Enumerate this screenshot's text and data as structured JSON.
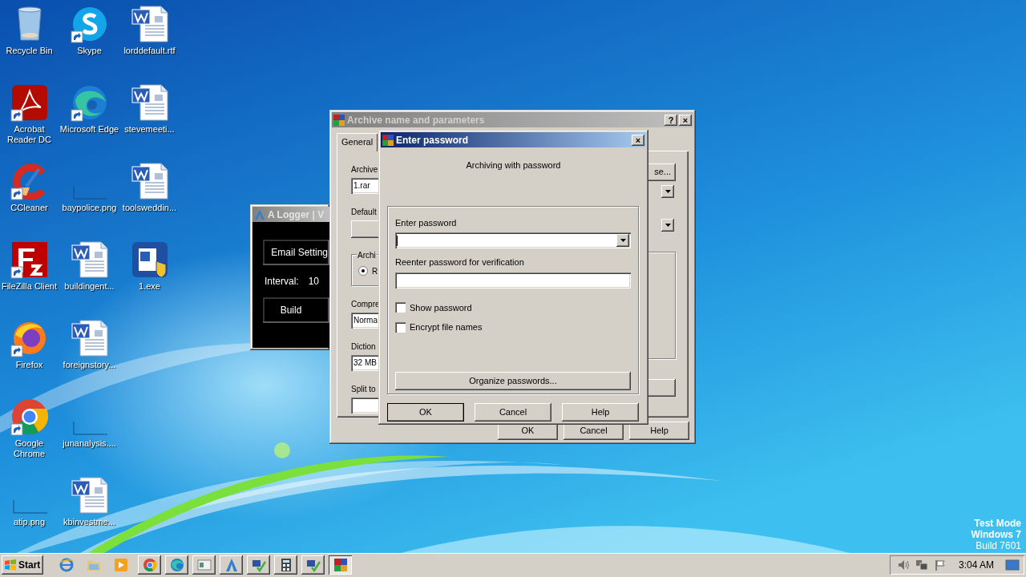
{
  "desktop_icons": [
    {
      "label": "Recycle Bin",
      "kind": "recycle",
      "shortcut": false
    },
    {
      "label": "Acrobat\nReader DC",
      "kind": "acrobat",
      "shortcut": true
    },
    {
      "label": "CCleaner",
      "kind": "ccleaner",
      "shortcut": true
    },
    {
      "label": "FileZilla Client",
      "kind": "filezilla",
      "shortcut": true
    },
    {
      "label": "Firefox",
      "kind": "firefox",
      "shortcut": true
    },
    {
      "label": "Google\nChrome",
      "kind": "chrome",
      "shortcut": true
    },
    {
      "label": "atip.png",
      "kind": "blank",
      "shortcut": false
    },
    {
      "label": "Skype",
      "kind": "skype",
      "shortcut": true
    },
    {
      "label": "Microsoft Edge",
      "kind": "edge",
      "shortcut": true
    },
    {
      "label": "baypolice.png",
      "kind": "blank",
      "shortcut": false
    },
    {
      "label": "buildingent...",
      "kind": "word",
      "shortcut": false
    },
    {
      "label": "foreignstory...",
      "kind": "word",
      "shortcut": false
    },
    {
      "label": "junanalysis....",
      "kind": "blank",
      "shortcut": false
    },
    {
      "label": "kbinvestme...",
      "kind": "word",
      "shortcut": false
    },
    {
      "label": "lorddefault.rtf",
      "kind": "word",
      "shortcut": false
    },
    {
      "label": "stevemeeti...",
      "kind": "word",
      "shortcut": false
    },
    {
      "label": "toolsweddin...",
      "kind": "word",
      "shortcut": false
    },
    {
      "label": "1.exe",
      "kind": "exe",
      "shortcut": false
    }
  ],
  "logger_window": {
    "title": "A Logger | V",
    "email_button": "Email Setting",
    "interval_label": "Interval:",
    "interval_value": "10",
    "build_button": "Build"
  },
  "archive_window": {
    "title": "Archive name and parameters",
    "help_button": "?",
    "close_button": "×",
    "tab": {
      "label": "General",
      "selected": true
    },
    "left_column": [
      {
        "kind": "label",
        "text": "Archive"
      },
      {
        "kind": "field",
        "text": "1.rar"
      },
      {
        "kind": "label",
        "text": "Default"
      },
      {
        "kind": "button"
      },
      {
        "kind": "group",
        "text": "Archi",
        "radio": {
          "label": "R",
          "selected": true
        }
      },
      {
        "kind": "label",
        "text": "Compre"
      },
      {
        "kind": "combo",
        "text": "Norma"
      },
      {
        "kind": "label",
        "text": "Diction"
      },
      {
        "kind": "combo",
        "text": "32 MB"
      },
      {
        "kind": "label",
        "text": "Split to"
      },
      {
        "kind": "field"
      }
    ],
    "browse_button": "se...",
    "buttons": [
      "OK",
      "Cancel",
      "Help"
    ]
  },
  "password_dialog": {
    "title": "Enter password",
    "close_button": "×",
    "heading": "Archiving with password",
    "password_label": "Enter password",
    "verify_label": "Reenter password for verification",
    "checkboxes": [
      {
        "label": "Show password",
        "checked": false
      },
      {
        "label": "Encrypt file names",
        "checked": false
      }
    ],
    "organize_button": "Organize passwords...",
    "buttons": [
      {
        "label": "OK",
        "default": true
      },
      {
        "label": "Cancel",
        "default": false
      },
      {
        "label": "Help",
        "default": false
      }
    ]
  },
  "os_notice": [
    "Test Mode",
    "Windows 7",
    "Build 7601"
  ],
  "taskbar": {
    "start": "Start",
    "items": [
      {
        "kind": "ie",
        "selected": false
      },
      {
        "kind": "folder",
        "selected": false
      },
      {
        "kind": "media",
        "selected": false
      },
      {
        "kind": "chrome",
        "selected": false
      },
      {
        "kind": "edge",
        "selected": false
      },
      {
        "kind": "window",
        "selected": false
      },
      {
        "kind": "logger",
        "selected": false
      },
      {
        "kind": "setup",
        "selected": false
      },
      {
        "kind": "calc",
        "selected": false
      },
      {
        "kind": "setup",
        "selected": false
      },
      {
        "kind": "winrar",
        "selected": true
      }
    ],
    "clock": "3:04 AM"
  }
}
